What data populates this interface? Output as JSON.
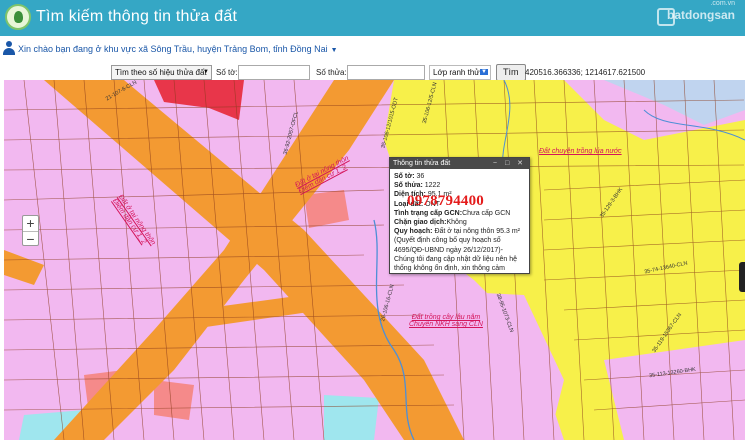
{
  "header": {
    "title": "Tìm kiếm thông tin thửa đất",
    "watermark": "batdongsan",
    "watermark_domain": ".com.vn"
  },
  "location_bar": {
    "greeting": "Xin chào bạn đang ở khu vực",
    "area": "xã Sông Trầu, huyện Trảng Bom, tỉnh Đồng Nai"
  },
  "search_bar": {
    "mode_select": "Tìm theo số hiệu thửa đất",
    "sheet_label": "Số tờ:",
    "parcel_label": "Số thửa:",
    "layer_select": "Lớp ranh thửa",
    "search_button": "Tìm",
    "coordinates": "420516.366336; 1214617.621500"
  },
  "map": {
    "zoom_in": "+",
    "zoom_out": "−",
    "colors": {
      "residential": "#f2b8f0",
      "road": "#f39a32",
      "perennial": "#f7f04a",
      "water": "#9fe6ee",
      "red_zone": "#e8364a",
      "salmon": "#f58a8a",
      "boundary": "#8a3a1a"
    },
    "labels": [
      {
        "text": "Đất ở tại nông thôn",
        "sub": "Điểm dân cư 1_2"
      },
      {
        "text": "Đất ở tại nông thôn",
        "sub": "Điểm dân cư 1_2"
      },
      {
        "text": "Đất chuyên trồng lúa nước",
        "sub": ""
      },
      {
        "text": "Đất trồng cây lâu năm",
        "sub": "Chuyển NKH sang CLN"
      }
    ],
    "parcels": [
      "21-107-6-CLN",
      "35-106-12/1015-ODT",
      "35-106-12/5-CLN",
      "36-92-2057-OFCL",
      "35-129-3-BHK",
      "35-74-13640-CLN",
      "38-95-1073-CLN",
      "35-119-15367-CLN",
      "35-113-13260-BHK",
      "26-106-16-CLN"
    ]
  },
  "popup": {
    "title": "Thông tin thửa đất",
    "controls": "− □ ✕",
    "rows": [
      {
        "label": "Số tờ:",
        "value": "36"
      },
      {
        "label": "Số thửa:",
        "value": "1222"
      },
      {
        "label": "Diện tích:",
        "value": "95.1 m²"
      },
      {
        "label": "Loại đất:",
        "value": "ONT"
      },
      {
        "label": "Tình trạng cấp GCN:",
        "value": "Chưa cấp GCN"
      },
      {
        "label": "Chặn giao dịch:",
        "value": "Không"
      },
      {
        "label": "Quy hoạch:",
        "value": "Đất ở tại nông thôn 95.3 m²"
      }
    ],
    "note": "(Quyết định công bố quy hoạch số 4695/QĐ-UBND ngày 26/12/2017)- Chúng tôi đang cập nhật dữ liệu nên hệ thống không ổn định, xin thông cảm",
    "phone": "0978794400"
  }
}
